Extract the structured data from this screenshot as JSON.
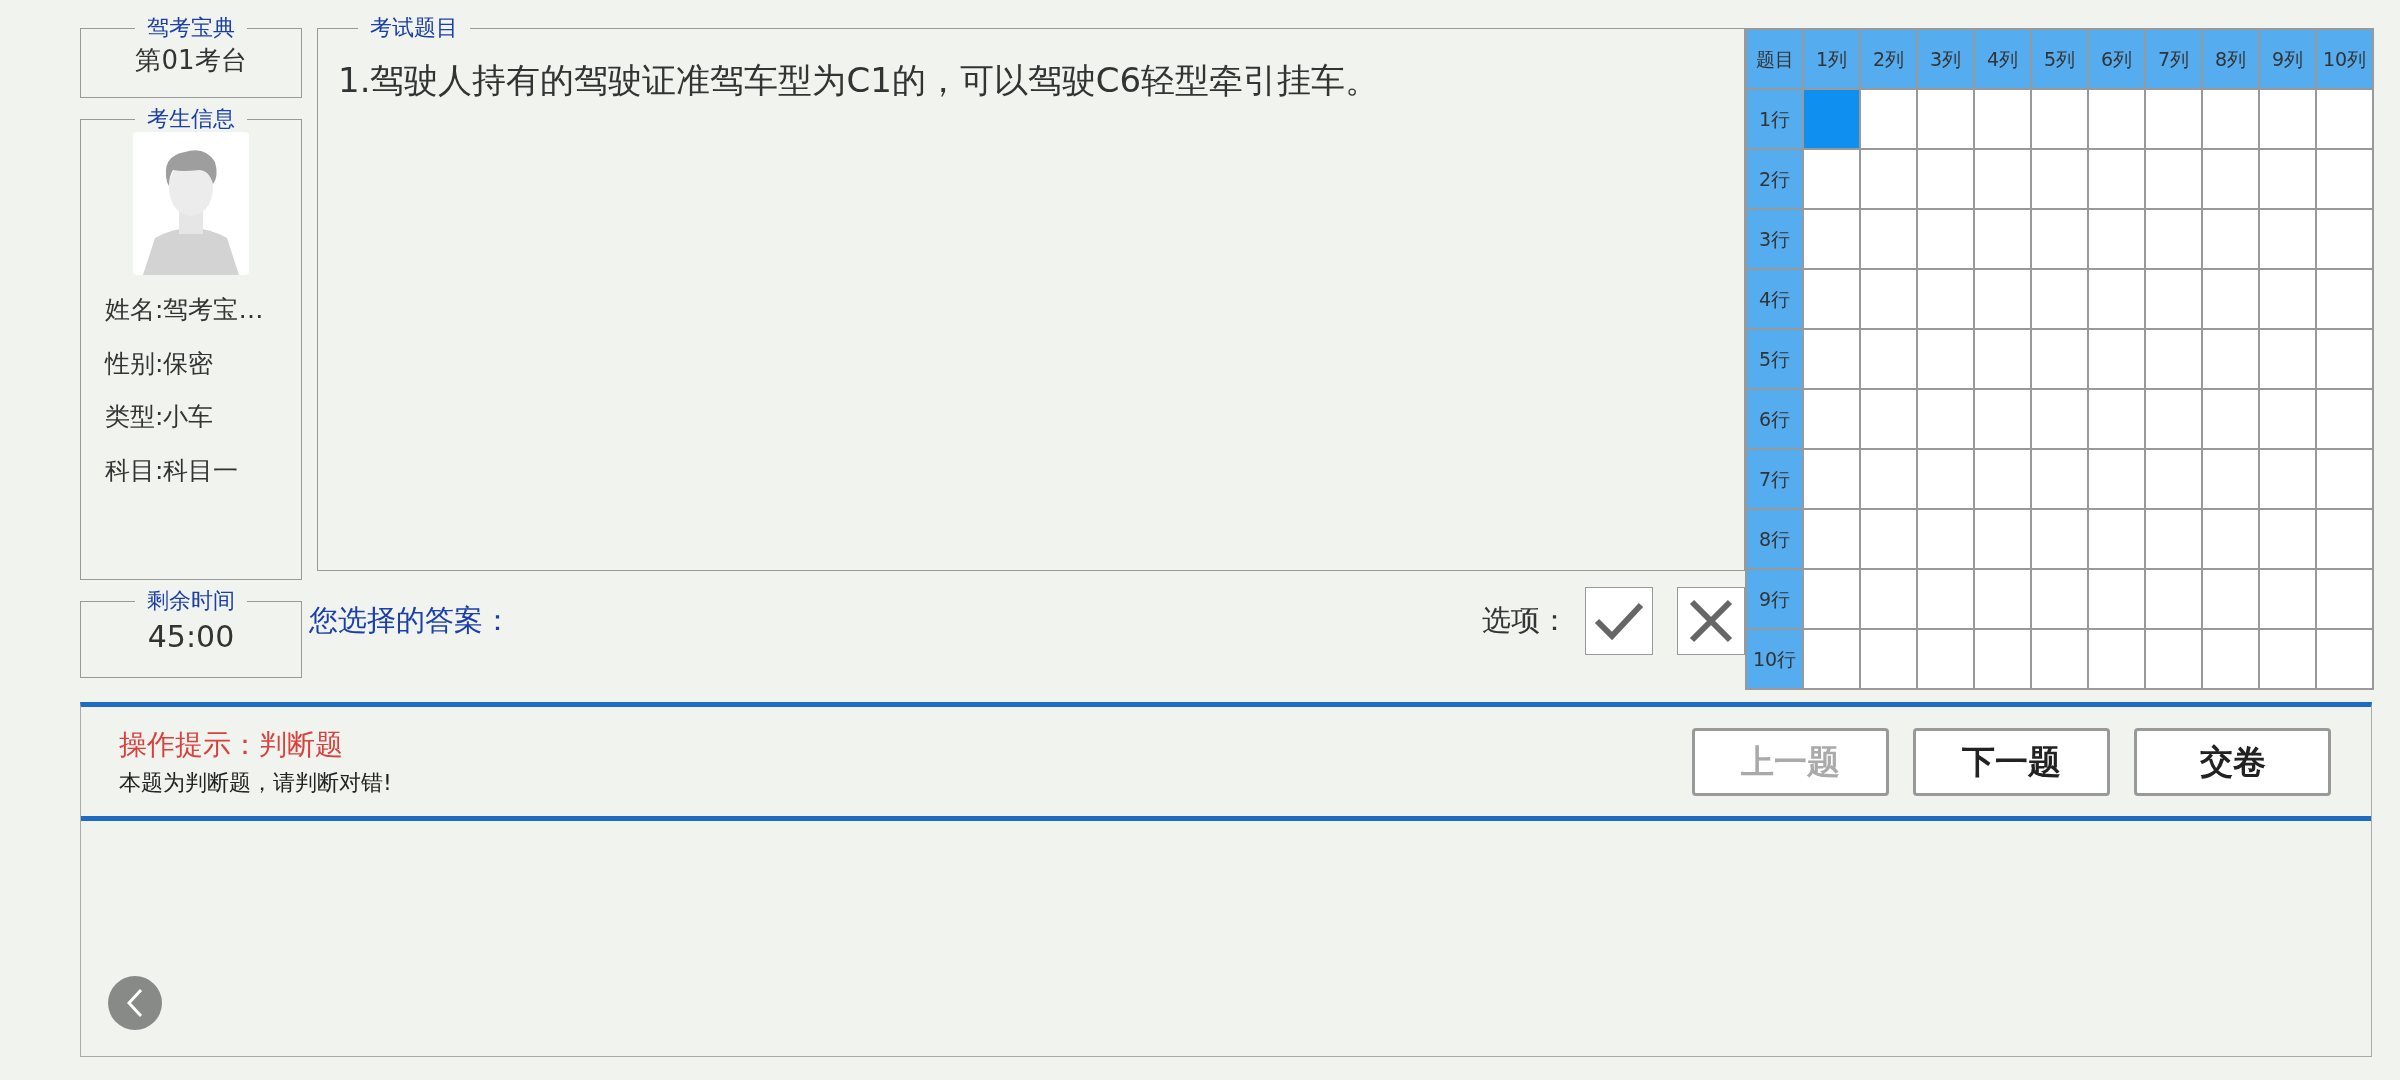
{
  "exam_station": {
    "title": "驾考宝典",
    "value": "第01考台"
  },
  "candidate": {
    "title": "考生信息",
    "fields": [
      "姓名:驾考宝…",
      "性别:保密",
      "类型:小车",
      "科目:科目一"
    ]
  },
  "timer": {
    "title": "剩余时间",
    "value": "45:00"
  },
  "question": {
    "title": "考试题目",
    "text": "1.驾驶人持有的驾驶证准驾车型为C1的，可以驾驶C6轻型牵引挂车。"
  },
  "answer": {
    "label": "您选择的答案：",
    "options_label": "选项：",
    "options": [
      {
        "kind": "correct"
      },
      {
        "kind": "wrong"
      }
    ]
  },
  "answer_sheet": {
    "corner": "题目",
    "columns": [
      "1列",
      "2列",
      "3列",
      "4列",
      "5列",
      "6列",
      "7列",
      "8列",
      "9列",
      "10列"
    ],
    "rows": [
      {
        "label": "1行",
        "cells": [
          {
            "selected": true
          },
          {
            "selected": false
          },
          {
            "selected": false
          },
          {
            "selected": false
          },
          {
            "selected": false
          },
          {
            "selected": false
          },
          {
            "selected": false
          },
          {
            "selected": false
          },
          {
            "selected": false
          },
          {
            "selected": false
          }
        ]
      },
      {
        "label": "2行",
        "cells": [
          {
            "selected": false
          },
          {
            "selected": false
          },
          {
            "selected": false
          },
          {
            "selected": false
          },
          {
            "selected": false
          },
          {
            "selected": false
          },
          {
            "selected": false
          },
          {
            "selected": false
          },
          {
            "selected": false
          },
          {
            "selected": false
          }
        ]
      },
      {
        "label": "3行",
        "cells": [
          {
            "selected": false
          },
          {
            "selected": false
          },
          {
            "selected": false
          },
          {
            "selected": false
          },
          {
            "selected": false
          },
          {
            "selected": false
          },
          {
            "selected": false
          },
          {
            "selected": false
          },
          {
            "selected": false
          },
          {
            "selected": false
          }
        ]
      },
      {
        "label": "4行",
        "cells": [
          {
            "selected": false
          },
          {
            "selected": false
          },
          {
            "selected": false
          },
          {
            "selected": false
          },
          {
            "selected": false
          },
          {
            "selected": false
          },
          {
            "selected": false
          },
          {
            "selected": false
          },
          {
            "selected": false
          },
          {
            "selected": false
          }
        ]
      },
      {
        "label": "5行",
        "cells": [
          {
            "selected": false
          },
          {
            "selected": false
          },
          {
            "selected": false
          },
          {
            "selected": false
          },
          {
            "selected": false
          },
          {
            "selected": false
          },
          {
            "selected": false
          },
          {
            "selected": false
          },
          {
            "selected": false
          },
          {
            "selected": false
          }
        ]
      },
      {
        "label": "6行",
        "cells": [
          {
            "selected": false
          },
          {
            "selected": false
          },
          {
            "selected": false
          },
          {
            "selected": false
          },
          {
            "selected": false
          },
          {
            "selected": false
          },
          {
            "selected": false
          },
          {
            "selected": false
          },
          {
            "selected": false
          },
          {
            "selected": false
          }
        ]
      },
      {
        "label": "7行",
        "cells": [
          {
            "selected": false
          },
          {
            "selected": false
          },
          {
            "selected": false
          },
          {
            "selected": false
          },
          {
            "selected": false
          },
          {
            "selected": false
          },
          {
            "selected": false
          },
          {
            "selected": false
          },
          {
            "selected": false
          },
          {
            "selected": false
          }
        ]
      },
      {
        "label": "8行",
        "cells": [
          {
            "selected": false
          },
          {
            "selected": false
          },
          {
            "selected": false
          },
          {
            "selected": false
          },
          {
            "selected": false
          },
          {
            "selected": false
          },
          {
            "selected": false
          },
          {
            "selected": false
          },
          {
            "selected": false
          },
          {
            "selected": false
          }
        ]
      },
      {
        "label": "9行",
        "cells": [
          {
            "selected": false
          },
          {
            "selected": false
          },
          {
            "selected": false
          },
          {
            "selected": false
          },
          {
            "selected": false
          },
          {
            "selected": false
          },
          {
            "selected": false
          },
          {
            "selected": false
          },
          {
            "selected": false
          },
          {
            "selected": false
          }
        ]
      },
      {
        "label": "10行",
        "cells": [
          {
            "selected": false
          },
          {
            "selected": false
          },
          {
            "selected": false
          },
          {
            "selected": false
          },
          {
            "selected": false
          },
          {
            "selected": false
          },
          {
            "selected": false
          },
          {
            "selected": false
          },
          {
            "selected": false
          },
          {
            "selected": false
          }
        ]
      }
    ]
  },
  "hint": {
    "title": "操作提示：判断题",
    "text": "本题为判断题，请判断对错!"
  },
  "buttons": [
    {
      "label": "上一题",
      "disabled": true
    },
    {
      "label": "下一题",
      "disabled": false
    },
    {
      "label": "交卷",
      "disabled": false
    }
  ]
}
